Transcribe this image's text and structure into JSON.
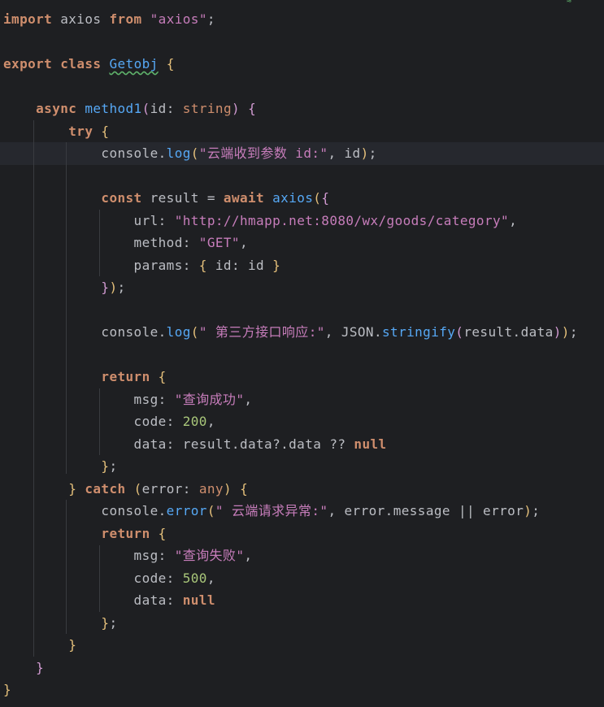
{
  "editor": {
    "colors": {
      "background": "#1e1f22",
      "keyword": "#cf8e6d",
      "string": "#c77dbb",
      "function": "#56a8f5",
      "number": "#2aacb8",
      "text": "#bcbec4"
    },
    "current_line_index": 6,
    "lines": [
      [
        {
          "t": "import",
          "c": "kw"
        },
        {
          "t": " axios ",
          "c": "punc"
        },
        {
          "t": "from",
          "c": "kw"
        },
        {
          "t": " ",
          "c": "punc"
        },
        {
          "t": "\"axios\"",
          "c": "str"
        },
        {
          "t": ";",
          "c": "punc"
        }
      ],
      [],
      [
        {
          "t": "export",
          "c": "kw"
        },
        {
          "t": " ",
          "c": "punc"
        },
        {
          "t": "class",
          "c": "kw"
        },
        {
          "t": " ",
          "c": "punc"
        },
        {
          "t": "Getobj",
          "c": "cls"
        },
        {
          "t": " ",
          "c": "punc"
        },
        {
          "t": "{",
          "c": "br1"
        }
      ],
      [],
      [
        {
          "t": "    ",
          "c": "ind"
        },
        {
          "t": "async",
          "c": "kw"
        },
        {
          "t": " ",
          "c": "punc"
        },
        {
          "t": "method1",
          "c": "fn"
        },
        {
          "t": "(",
          "c": "br2"
        },
        {
          "t": "id: ",
          "c": "punc"
        },
        {
          "t": "string",
          "c": "type"
        },
        {
          "t": ")",
          "c": "br2"
        },
        {
          "t": " ",
          "c": "punc"
        },
        {
          "t": "{",
          "c": "br2"
        }
      ],
      [
        {
          "t": "        ",
          "c": "ind"
        },
        {
          "t": "try",
          "c": "kw"
        },
        {
          "t": " ",
          "c": "punc"
        },
        {
          "t": "{",
          "c": "br1"
        }
      ],
      [
        {
          "t": "            ",
          "c": "ind"
        },
        {
          "t": "console.",
          "c": "punc"
        },
        {
          "t": "log",
          "c": "fn"
        },
        {
          "t": "(",
          "c": "br1"
        },
        {
          "t": "\"云端收到参数 id:\"",
          "c": "str"
        },
        {
          "t": ", id",
          "c": "punc"
        },
        {
          "t": ")",
          "c": "br1"
        },
        {
          "t": ";",
          "c": "punc"
        }
      ],
      [],
      [
        {
          "t": "            ",
          "c": "ind"
        },
        {
          "t": "const",
          "c": "kw"
        },
        {
          "t": " result = ",
          "c": "punc"
        },
        {
          "t": "await",
          "c": "kw"
        },
        {
          "t": " ",
          "c": "punc"
        },
        {
          "t": "axios",
          "c": "fn"
        },
        {
          "t": "(",
          "c": "br1"
        },
        {
          "t": "{",
          "c": "br2"
        }
      ],
      [
        {
          "t": "                ",
          "c": "ind"
        },
        {
          "t": "url: ",
          "c": "punc"
        },
        {
          "t": "\"http://hmapp.net:8080/wx/goods/category\"",
          "c": "str"
        },
        {
          "t": ",",
          "c": "punc"
        }
      ],
      [
        {
          "t": "                ",
          "c": "ind"
        },
        {
          "t": "method: ",
          "c": "punc"
        },
        {
          "t": "\"GET\"",
          "c": "str"
        },
        {
          "t": ",",
          "c": "punc"
        }
      ],
      [
        {
          "t": "                ",
          "c": "ind"
        },
        {
          "t": "params: ",
          "c": "punc"
        },
        {
          "t": "{",
          "c": "br1"
        },
        {
          "t": " id: id ",
          "c": "punc"
        },
        {
          "t": "}",
          "c": "br1"
        }
      ],
      [
        {
          "t": "            ",
          "c": "ind"
        },
        {
          "t": "}",
          "c": "br2"
        },
        {
          "t": ")",
          "c": "br1"
        },
        {
          "t": ";",
          "c": "punc"
        }
      ],
      [],
      [
        {
          "t": "            ",
          "c": "ind"
        },
        {
          "t": "console.",
          "c": "punc"
        },
        {
          "t": "log",
          "c": "fn"
        },
        {
          "t": "(",
          "c": "br1"
        },
        {
          "t": "\" 第三方接口响应:\"",
          "c": "str"
        },
        {
          "t": ", JSON.",
          "c": "punc"
        },
        {
          "t": "stringify",
          "c": "fn"
        },
        {
          "t": "(",
          "c": "br2"
        },
        {
          "t": "result.data",
          "c": "punc"
        },
        {
          "t": ")",
          "c": "br2"
        },
        {
          "t": ")",
          "c": "br1"
        },
        {
          "t": ";",
          "c": "punc"
        }
      ],
      [],
      [
        {
          "t": "            ",
          "c": "ind"
        },
        {
          "t": "return",
          "c": "kw"
        },
        {
          "t": " ",
          "c": "punc"
        },
        {
          "t": "{",
          "c": "br1"
        }
      ],
      [
        {
          "t": "                ",
          "c": "ind"
        },
        {
          "t": "msg: ",
          "c": "punc"
        },
        {
          "t": "\"查询成功\"",
          "c": "str"
        },
        {
          "t": ",",
          "c": "punc"
        }
      ],
      [
        {
          "t": "                ",
          "c": "ind"
        },
        {
          "t": "code: ",
          "c": "punc"
        },
        {
          "t": "200",
          "c": "num2"
        },
        {
          "t": ",",
          "c": "punc"
        }
      ],
      [
        {
          "t": "                ",
          "c": "ind"
        },
        {
          "t": "data: result.data?.data ?? ",
          "c": "punc"
        },
        {
          "t": "null",
          "c": "lit"
        }
      ],
      [
        {
          "t": "            ",
          "c": "ind"
        },
        {
          "t": "}",
          "c": "br1"
        },
        {
          "t": ";",
          "c": "punc"
        }
      ],
      [
        {
          "t": "        ",
          "c": "ind"
        },
        {
          "t": "}",
          "c": "br1"
        },
        {
          "t": " ",
          "c": "punc"
        },
        {
          "t": "catch",
          "c": "kw"
        },
        {
          "t": " ",
          "c": "punc"
        },
        {
          "t": "(",
          "c": "br1"
        },
        {
          "t": "error: ",
          "c": "punc"
        },
        {
          "t": "any",
          "c": "type"
        },
        {
          "t": ")",
          "c": "br1"
        },
        {
          "t": " ",
          "c": "punc"
        },
        {
          "t": "{",
          "c": "br1"
        }
      ],
      [
        {
          "t": "            ",
          "c": "ind"
        },
        {
          "t": "console.",
          "c": "punc"
        },
        {
          "t": "error",
          "c": "fn"
        },
        {
          "t": "(",
          "c": "br1"
        },
        {
          "t": "\" 云端请求异常:\"",
          "c": "str"
        },
        {
          "t": ", error.message || error",
          "c": "punc"
        },
        {
          "t": ")",
          "c": "br1"
        },
        {
          "t": ";",
          "c": "punc"
        }
      ],
      [
        {
          "t": "            ",
          "c": "ind"
        },
        {
          "t": "return",
          "c": "kw"
        },
        {
          "t": " ",
          "c": "punc"
        },
        {
          "t": "{",
          "c": "br1"
        }
      ],
      [
        {
          "t": "                ",
          "c": "ind"
        },
        {
          "t": "msg: ",
          "c": "punc"
        },
        {
          "t": "\"查询失败\"",
          "c": "str"
        },
        {
          "t": ",",
          "c": "punc"
        }
      ],
      [
        {
          "t": "                ",
          "c": "ind"
        },
        {
          "t": "code: ",
          "c": "punc"
        },
        {
          "t": "500",
          "c": "num2"
        },
        {
          "t": ",",
          "c": "punc"
        }
      ],
      [
        {
          "t": "                ",
          "c": "ind"
        },
        {
          "t": "data: ",
          "c": "punc"
        },
        {
          "t": "null",
          "c": "lit"
        }
      ],
      [
        {
          "t": "            ",
          "c": "ind"
        },
        {
          "t": "}",
          "c": "br1"
        },
        {
          "t": ";",
          "c": "punc"
        }
      ],
      [
        {
          "t": "        ",
          "c": "ind"
        },
        {
          "t": "}",
          "c": "br1"
        }
      ],
      [
        {
          "t": "    ",
          "c": "ind"
        },
        {
          "t": "}",
          "c": "br2"
        }
      ],
      [
        {
          "t": "}",
          "c": "br1"
        }
      ]
    ]
  }
}
